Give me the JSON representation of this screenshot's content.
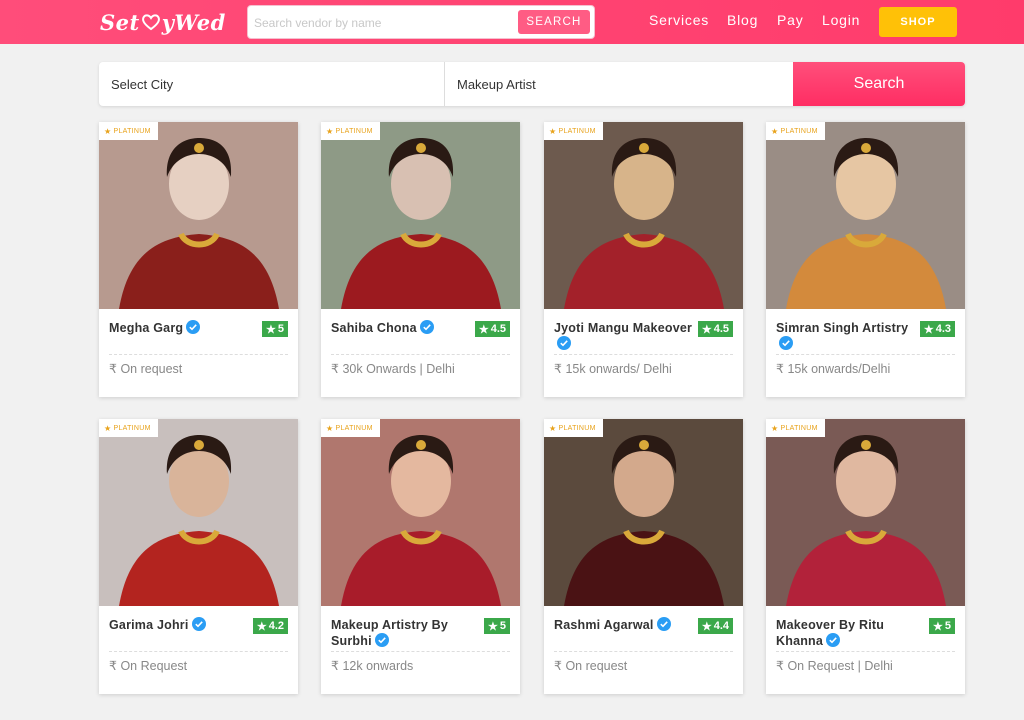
{
  "header": {
    "logo_left": "Set",
    "logo_right": "yWed",
    "search_placeholder": "Search vendor by name",
    "search_button": "SEARCH",
    "nav": [
      "Services",
      "Blog",
      "Pay",
      "Login"
    ],
    "shop_button": "SHOP"
  },
  "filter": {
    "city": "Select City",
    "category": "Makeup Artist",
    "search_button": "Search"
  },
  "badge_label": "PLATINUM",
  "currency_symbol": "₹",
  "vendors": [
    {
      "name": "Megha Garg",
      "rating": "5",
      "price": "On request"
    },
    {
      "name": "Sahiba Chona",
      "rating": "4.5",
      "price": "30k Onwards | Delhi"
    },
    {
      "name": "Jyoti Mangu Makeover",
      "rating": "4.5",
      "price": "15k onwards/ Delhi"
    },
    {
      "name": "Simran Singh Artistry",
      "rating": "4.3",
      "price": "15k onwards/Delhi"
    },
    {
      "name": "Garima Johri",
      "rating": "4.2",
      "price": "On Request"
    },
    {
      "name": "Makeup Artistry By Surbhi",
      "rating": "5",
      "price": "12k onwards"
    },
    {
      "name": "Rashmi Agarwal",
      "rating": "4.4",
      "price": "On request"
    },
    {
      "name": "Makeover By Ritu Khanna",
      "rating": "5",
      "price": "On Request | Delhi"
    }
  ],
  "colors": {
    "brand": "#ff3b6b",
    "shop": "#ffc107",
    "rating": "#3ba84a",
    "verified": "#2a9df4"
  }
}
